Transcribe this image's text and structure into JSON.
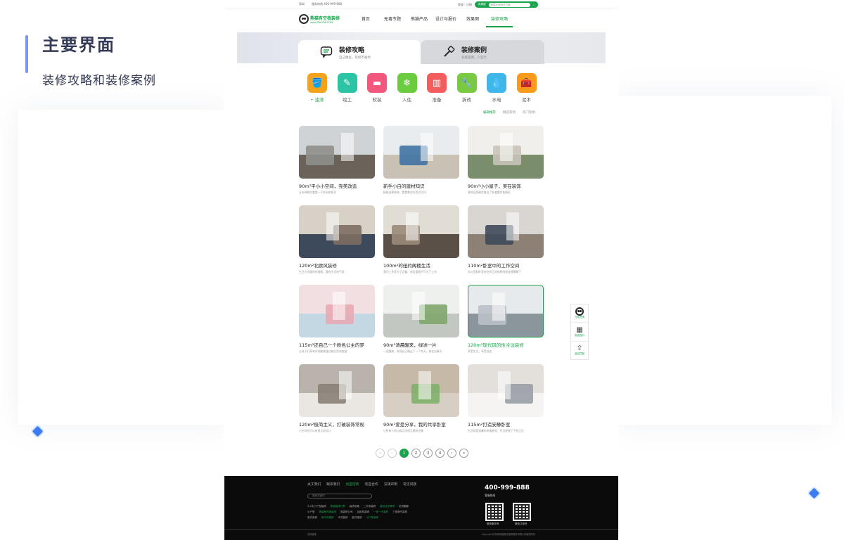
{
  "presentation": {
    "title": "主要界面",
    "subtitle": "装修攻略和装修案例"
  },
  "site": {
    "topbar": {
      "location": "深圳",
      "hotline": "服务热线 400-999-888",
      "login": "登录｜注册",
      "search_category": "效果图",
      "search_placeholder": "熊猫空间设计方案"
    },
    "logo": {
      "name": "熊猫有空我装修",
      "url_text": "www.PNOOW.COM"
    },
    "nav": [
      "首页",
      "无毒专题",
      "熊猫产品",
      "设计与报价",
      "效果图",
      "装修攻略"
    ],
    "tabs": [
      {
        "title": "装修攻略",
        "subtitle": "自己做主，装修不被坑"
      },
      {
        "title": "装修案例",
        "subtitle": "多看案例，少犯亏"
      }
    ],
    "categories": [
      {
        "label": "油漆",
        "color": "#f4a21c",
        "icon": "paint-bucket-icon"
      },
      {
        "label": "竣工",
        "color": "#2cc4a4",
        "icon": "brush-icon"
      },
      {
        "label": "软装",
        "color": "#f2577e",
        "icon": "sofa-icon"
      },
      {
        "label": "入住",
        "color": "#6ccc3f",
        "icon": "air-conditioner-icon"
      },
      {
        "label": "准备",
        "color": "#f25e5e",
        "icon": "ruler-icon"
      },
      {
        "label": "拆改",
        "color": "#7ac943",
        "icon": "wrench-icon"
      },
      {
        "label": "水电",
        "color": "#3fb7ea",
        "icon": "water-drop-icon"
      },
      {
        "label": "泥木",
        "color": "#f79a1e",
        "icon": "toolbox-icon"
      }
    ],
    "filters": [
      "编辑推荐",
      "精选案例",
      "热门案例"
    ],
    "articles": [
      {
        "title": "90m²平小小空间，完美改造",
        "desc": "让米神帮你看看一下空间的知识"
      },
      {
        "title": "新手小白的建材知识",
        "desc": "精挑选择装修，看看哪些东西对大伴"
      },
      {
        "title": "90m²小小屋子，美在装饰",
        "desc": "装饰品质确实做出了多看看的各情形"
      },
      {
        "title": "120m²北欧风装修",
        "desc": "生活方式跟你的意图，要有生活的气氛"
      },
      {
        "title": "100m²的纽约阁楼生活",
        "desc": "我们工作室为了设备、前后看看不只为了工作"
      },
      {
        "title": "110m²卧室中的工作空间",
        "desc": "办公室和卧室的空间之间的界限就变得模糊了"
      },
      {
        "title": "115m²还自己一个粉色公主的梦",
        "desc": "让孩子们享有共同能够通过粉红色的房屋"
      },
      {
        "title": "90m²清晨醒来，绿洲一片",
        "desc": "一觉醒来，发现自己睡过了一个冬天，现在自春天"
      },
      {
        "title": "120m²现代风的性冷淡装修",
        "desc": "享受生活，享受自由"
      },
      {
        "title": "120m²极简主义，打破装饰常规",
        "desc": "小空间也可以有很大的设计"
      },
      {
        "title": "90m²爱是分享，我的共享卧室",
        "desc": "让所有人的心都之间相互都有交集"
      },
      {
        "title": "115m²打造安静卧室",
        "desc": "生活就是温馨的幸福感觉，并且舒服了下班之后"
      }
    ],
    "pagination": {
      "pages": [
        "1",
        "2",
        "3",
        "4"
      ],
      "current": 1
    },
    "footer": {
      "links": [
        "关于我们",
        "联系我们",
        "加盟招商",
        "欢迎合作",
        "法律声明",
        "常见问题"
      ],
      "active_link": "加盟招商",
      "search_placeholder": "搜索关键词",
      "rows": [
        [
          "3-4天小户型装修",
          "新城装修分享",
          "装修攻略",
          "二手房装修",
          "装修注意事项",
          "老房翻新"
        ],
        [
          "小户型",
          "精装房改造装修",
          "简装修公司",
          "北欧风装修",
          "一室一厅装修",
          "三室两厅装修"
        ],
        [
          "美式装修",
          "现代风装修",
          "中式装修",
          "欧式装修",
          "小户型装修"
        ]
      ],
      "phone": "400-999-888",
      "phone_label": "客服热线",
      "qr_labels": [
        "微信服务号",
        "微信订阅号"
      ],
      "copyright": "Copyright@深圳熊猫有空装修服务有限公司版权所有",
      "friend_links": "友情链接"
    },
    "sidebar": [
      "在线咨询",
      "免费报价",
      "返回顶部"
    ]
  }
}
